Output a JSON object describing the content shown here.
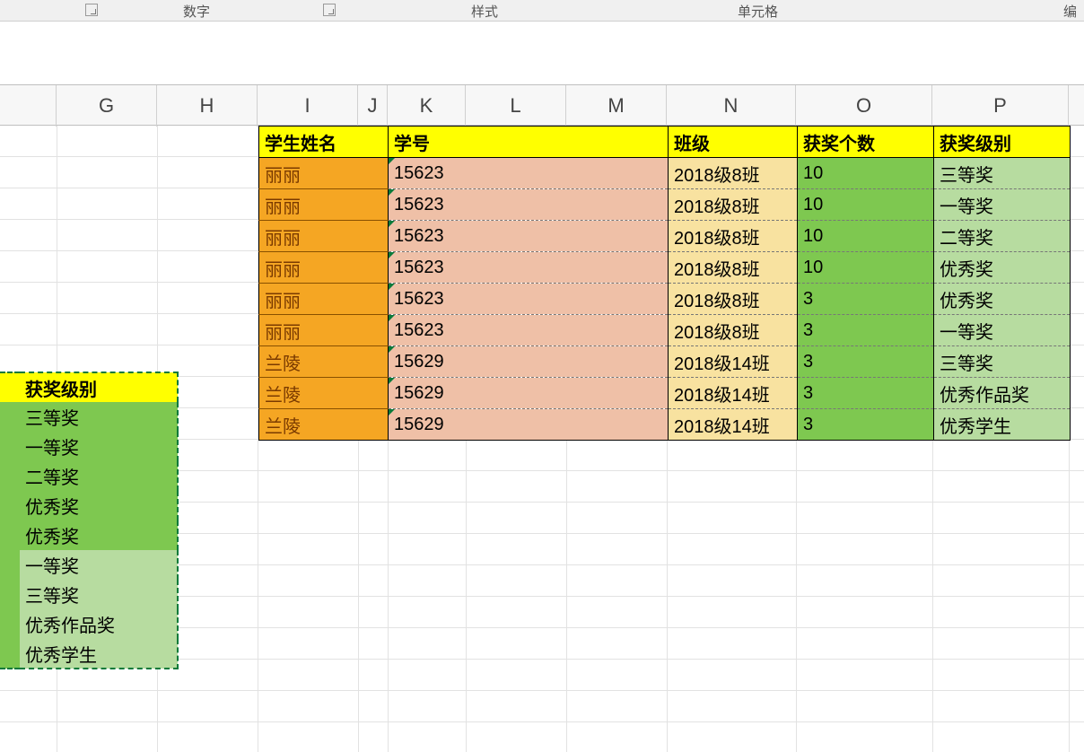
{
  "ribbon": {
    "groups": [
      "数字",
      "样式",
      "单元格",
      "编"
    ]
  },
  "columns": [
    "G",
    "H",
    "I",
    "J",
    "K",
    "L",
    "M",
    "N",
    "O",
    "P"
  ],
  "main": {
    "headers": {
      "name": "学生姓名",
      "id": "学号",
      "class": "班级",
      "count": "获奖个数",
      "level": "获奖级别"
    },
    "rows": [
      {
        "name": "丽丽",
        "id": "15623",
        "class": "2018级8班",
        "count": "10",
        "level": "三等奖"
      },
      {
        "name": "丽丽",
        "id": "15623",
        "class": "2018级8班",
        "count": "10",
        "level": "一等奖"
      },
      {
        "name": "丽丽",
        "id": "15623",
        "class": "2018级8班",
        "count": "10",
        "level": "二等奖"
      },
      {
        "name": "丽丽",
        "id": "15623",
        "class": "2018级8班",
        "count": "10",
        "level": "优秀奖"
      },
      {
        "name": "丽丽",
        "id": "15623",
        "class": "2018级8班",
        "count": "3",
        "level": "优秀奖"
      },
      {
        "name": "丽丽",
        "id": "15623",
        "class": "2018级8班",
        "count": "3",
        "level": "一等奖"
      },
      {
        "name": "兰陵",
        "id": "15629",
        "class": "2018级14班",
        "count": "3",
        "level": "三等奖"
      },
      {
        "name": "兰陵",
        "id": "15629",
        "class": "2018级14班",
        "count": "3",
        "level": "优秀作品奖"
      },
      {
        "name": "兰陵",
        "id": "15629",
        "class": "2018级14班",
        "count": "3",
        "level": "优秀学生"
      }
    ]
  },
  "side": {
    "header": "获奖级别",
    "items": [
      "三等奖",
      "一等奖",
      "二等奖",
      "优秀奖",
      "优秀奖",
      "一等奖",
      "三等奖",
      "优秀作品奖",
      "优秀学生"
    ]
  }
}
